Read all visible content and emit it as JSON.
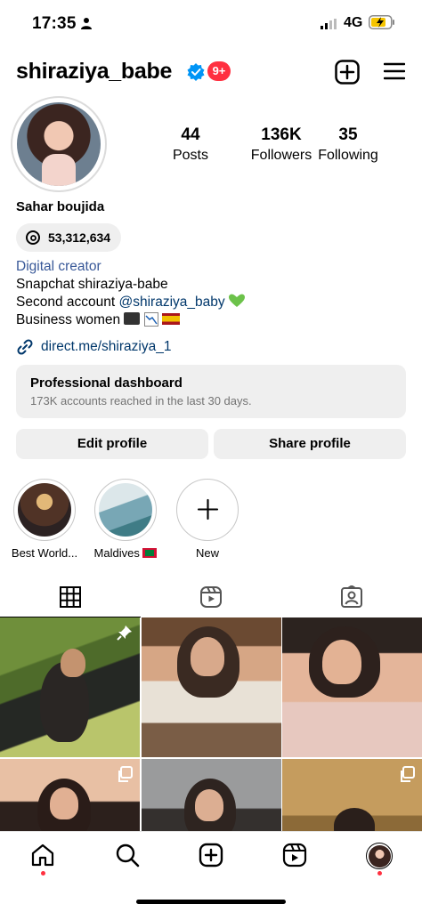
{
  "status_bar": {
    "time": "17:35",
    "network": "4G",
    "icons": [
      "person-icon",
      "signal-icon",
      "battery-charging-icon"
    ]
  },
  "header": {
    "username": "shiraziya_babe",
    "notification_badge": "9+",
    "icons": [
      "verified-icon",
      "create-icon",
      "menu-icon"
    ]
  },
  "stats": [
    {
      "value": "44",
      "label": "Posts"
    },
    {
      "value": "136K",
      "label": "Followers"
    },
    {
      "value": "35",
      "label": "Following"
    }
  ],
  "profile": {
    "display_name": "Sahar boujida",
    "threads_count": "53,312,634",
    "category": "Digital creator",
    "bio_line1": "Snapchat shiraziya-babe",
    "bio_line2_prefix": "Second account ",
    "bio_line2_mention": "@shiraziya_baby",
    "bio_line3": "Business women",
    "link": "direct.me/shiraziya_1"
  },
  "dashboard": {
    "title": "Professional dashboard",
    "subtitle": "173K accounts reached in the last 30 days."
  },
  "actions": {
    "edit_label": "Edit profile",
    "share_label": "Share profile"
  },
  "highlights": [
    {
      "label": "Best World..."
    },
    {
      "label": "Maldives"
    },
    {
      "label": "New"
    }
  ],
  "tabs": {
    "icons": [
      "grid-icon",
      "reels-icon",
      "tagged-icon"
    ],
    "active": "grid-icon"
  },
  "bottom_nav": {
    "icons": [
      "home-icon",
      "search-icon",
      "create-icon",
      "reels-icon",
      "profile-avatar"
    ]
  },
  "colors": {
    "accent_blue": "#0095f6",
    "link_blue": "#00376b",
    "badge_red": "#ff3040",
    "button_gray": "#efefef",
    "heart_green": "#4caf50"
  }
}
